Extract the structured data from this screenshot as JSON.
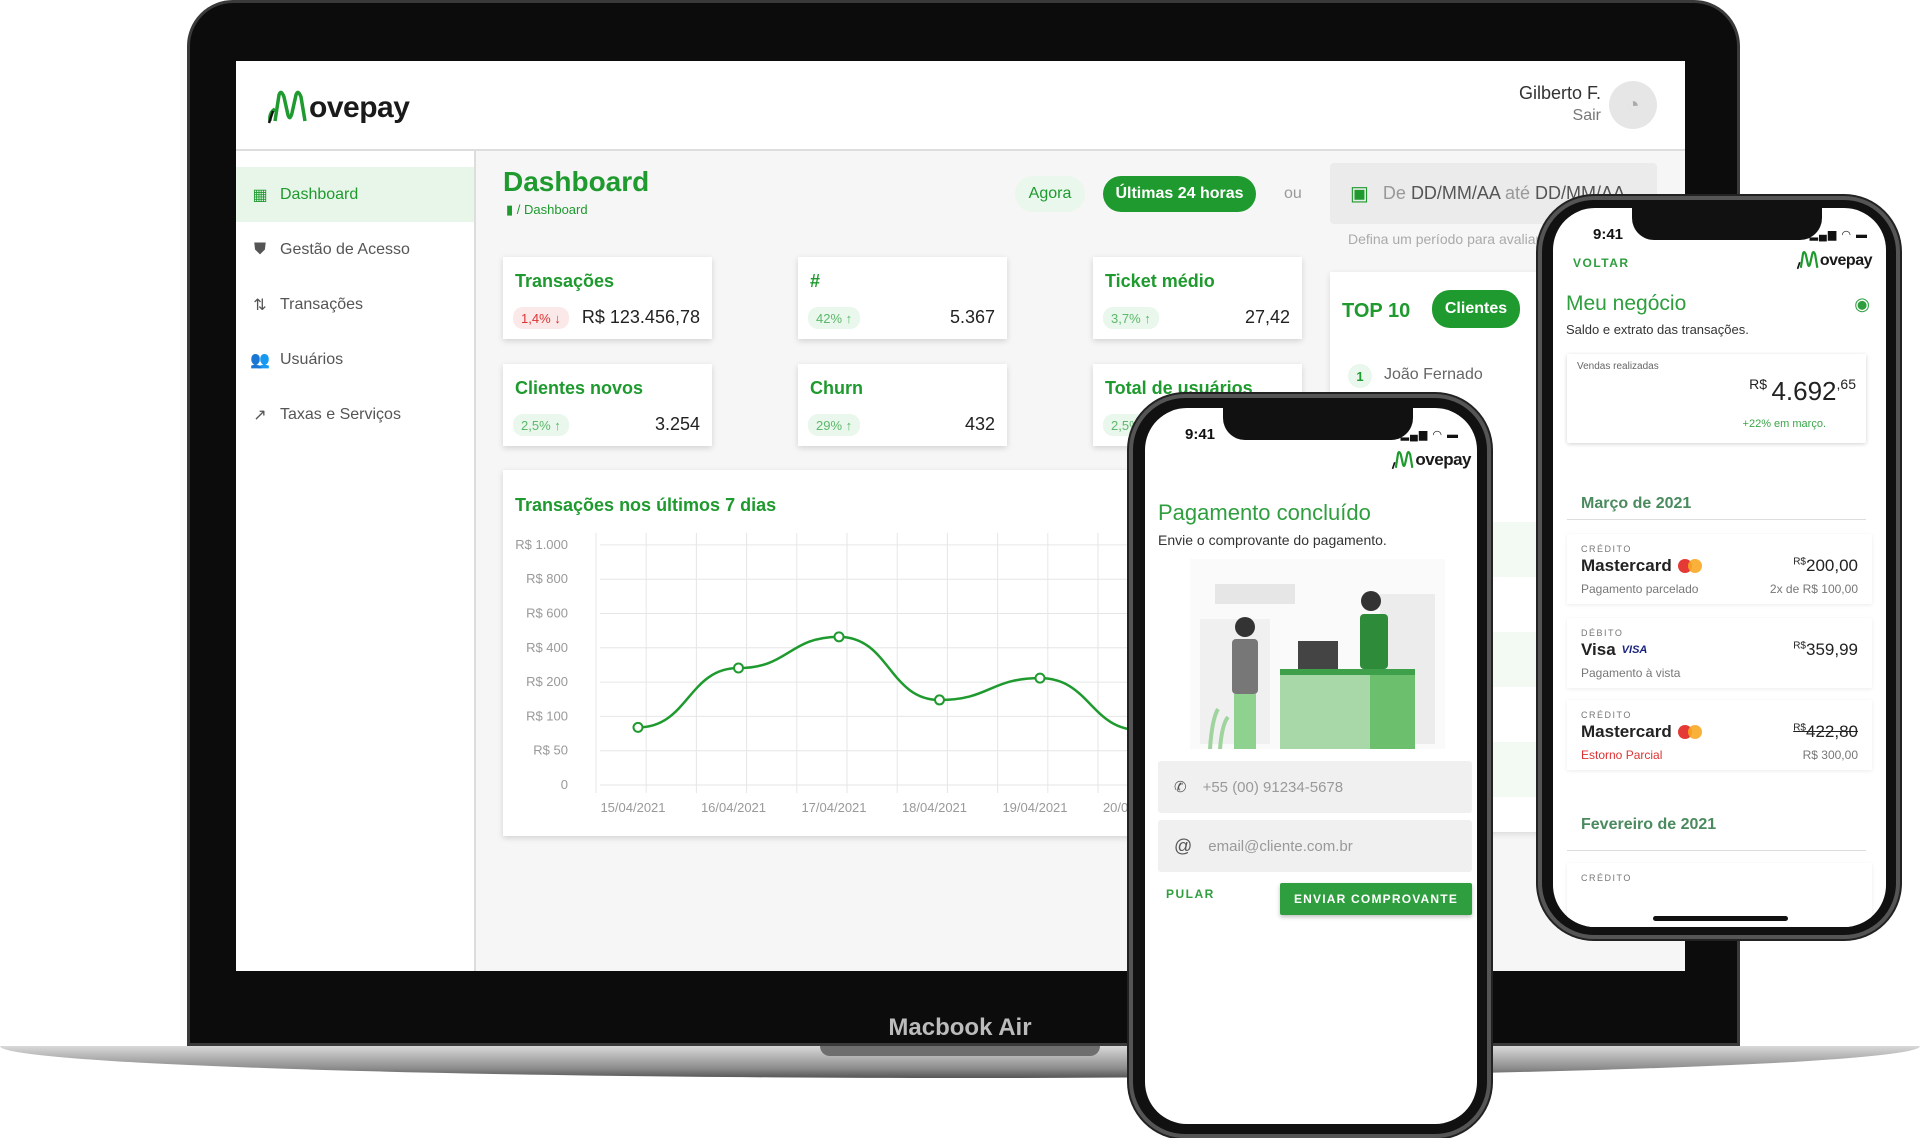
{
  "device_label": "Macbook Air",
  "app": {
    "logo_text": "ovepay",
    "logo_brand": "Movepay",
    "accent_color": "#1e9a2e"
  },
  "header": {
    "user_name": "Gilberto F.",
    "logout": "Sair",
    "avatar_icon": "user-avatar-icon"
  },
  "sidebar": {
    "items": [
      {
        "label": "Dashboard",
        "icon": "dashboard-icon",
        "active": true
      },
      {
        "label": "Gestão de Acesso",
        "icon": "shield-lock-icon"
      },
      {
        "label": "Transações",
        "icon": "swap-vertical-icon"
      },
      {
        "label": "Usuários",
        "icon": "users-icon"
      },
      {
        "label": "Taxas e Serviços",
        "icon": "chart-trend-icon"
      }
    ]
  },
  "main": {
    "title": "Dashboard",
    "breadcrumb": "/ Dashboard",
    "filters": {
      "now": "Agora",
      "last24": "Últimas 24 horas",
      "or": "ou",
      "date_from_prefix": "De",
      "date_from": "DD/MM/AA",
      "date_to_prefix": "até",
      "date_to": "DD/MM/AA",
      "hint": "Defina um período para avaliar"
    },
    "cards": [
      {
        "title": "Transações",
        "badge": "1,4% ↓",
        "trend": "down",
        "value": "R$ 123.456,78"
      },
      {
        "title": "#",
        "badge": "42% ↑",
        "trend": "up",
        "value": "5.367"
      },
      {
        "title": "Ticket médio",
        "badge": "3,7% ↑",
        "trend": "up",
        "value": "27,42"
      },
      {
        "title": "Clientes novos",
        "badge": "2,5% ↑",
        "trend": "up",
        "value": "3.254"
      },
      {
        "title": "Churn",
        "badge": "29% ↑",
        "trend": "up",
        "value": "432"
      },
      {
        "title": "Total de usuários",
        "badge": "2,5% ↑",
        "trend": "up",
        "value": ""
      }
    ],
    "top10": {
      "title": "TOP 10",
      "tab": "Clientes",
      "rows": [
        {
          "rank": "1",
          "name": "João Fernado"
        }
      ]
    }
  },
  "chart_data": {
    "type": "line",
    "title": "Transações nos últimos 7 dias",
    "categories": [
      "15/04/2021",
      "16/04/2021",
      "17/04/2021",
      "18/04/2021",
      "19/04/2021",
      "20/04/2021"
    ],
    "values": [
      84,
      282,
      464,
      148,
      223,
      80
    ],
    "y_ticks": [
      0,
      50,
      100,
      200,
      400,
      600,
      800,
      1000
    ],
    "y_tick_labels": [
      "0",
      "R$ 50",
      "R$ 100",
      "R$ 200",
      "R$ 400",
      "R$ 600",
      "R$ 800",
      "R$ 1.000"
    ],
    "ylim": [
      0,
      1000
    ],
    "grid": true,
    "color": "#1e9a2e",
    "xlabel": "",
    "ylabel": ""
  },
  "phone_payment": {
    "time": "9:41",
    "title": "Pagamento concluído",
    "subtitle": "Envie o comprovante do pagamento.",
    "phone_placeholder": "+55 (00) 91234-5678",
    "email_placeholder": "email@cliente.com.br",
    "skip": "PULAR",
    "send": "ENVIAR COMPROVANTE"
  },
  "phone_business": {
    "time": "9:41",
    "back": "VOLTAR",
    "title": "Meu negócio",
    "subtitle": "Saldo e extrato das transações.",
    "sales_label": "Vendas realizadas",
    "sales_currency": "R$",
    "sales_int": "4.692",
    "sales_cents": ",65",
    "sales_growth": "+22% em março.",
    "months": [
      {
        "label": "Março de 2021",
        "transactions": [
          {
            "type": "CRÉDITO",
            "brand": "Mastercard",
            "brand_icon": "mastercard-icon",
            "desc": "Pagamento parcelado",
            "currency": "R$",
            "amount": "200,00",
            "detail": "2x de R$ 100,00"
          },
          {
            "type": "DÉBITO",
            "brand": "Visa",
            "brand_icon": "visa-icon",
            "brand_mark": "VISA",
            "desc": "Pagamento à vista",
            "currency": "R$",
            "amount": "359,99",
            "detail": ""
          },
          {
            "type": "CRÉDITO",
            "brand": "Mastercard",
            "brand_icon": "mastercard-icon",
            "desc": "Estorno Parcial",
            "currency": "R$",
            "amount": "422,80",
            "detail": "R$ 300,00",
            "refunded": true
          }
        ]
      },
      {
        "label": "Fevereiro de 2021",
        "transactions": [
          {
            "type": "CRÉDITO"
          }
        ]
      }
    ]
  }
}
